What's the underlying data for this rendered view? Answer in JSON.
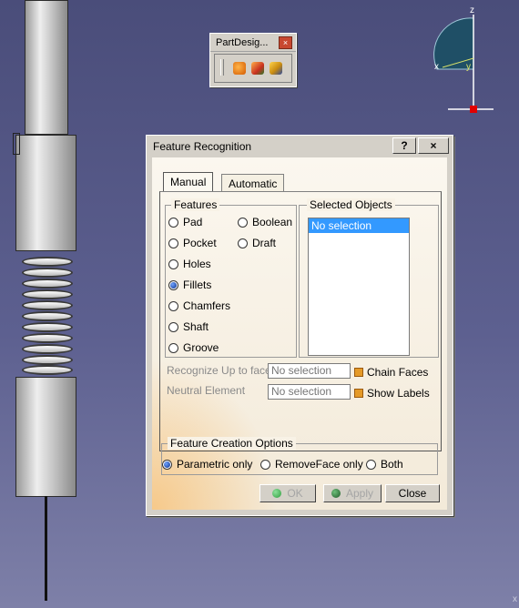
{
  "toolbar": {
    "title": "PartDesig...",
    "close": "×",
    "icons": [
      "recognize-feature-icon",
      "sketch-based-icon",
      "dress-up-icon"
    ]
  },
  "compass": {
    "z": "z",
    "x": "x",
    "y": "y"
  },
  "corner_label": "x",
  "dialog": {
    "title": "Feature Recognition",
    "help": "?",
    "close": "×",
    "tabs": [
      "Manual",
      "Automatic"
    ],
    "features_group": "Features",
    "features": [
      {
        "label": "Pad",
        "selected": false
      },
      {
        "label": "Boolean",
        "selected": false
      },
      {
        "label": "Pocket",
        "selected": false
      },
      {
        "label": "Draft",
        "selected": false
      },
      {
        "label": "Holes",
        "selected": false
      },
      {
        "label": "Fillets",
        "selected": true
      },
      {
        "label": "Chamfers",
        "selected": false
      },
      {
        "label": "Shaft",
        "selected": false
      },
      {
        "label": "Groove",
        "selected": false
      }
    ],
    "selected_objects_group": "Selected Objects",
    "selected_objects": [
      "No selection"
    ],
    "recognize_up_to_face": {
      "label": "Recognize Up to face",
      "value": "No selection"
    },
    "neutral_element": {
      "label": "Neutral Element",
      "value": "No selection"
    },
    "chain_faces": "Chain Faces",
    "show_labels": "Show Labels",
    "creation_options_group": "Feature Creation Options",
    "creation_options": [
      {
        "label": "Parametric only",
        "selected": true
      },
      {
        "label": "RemoveFace only",
        "selected": false
      },
      {
        "label": "Both",
        "selected": false
      }
    ],
    "buttons": {
      "ok": "OK",
      "apply": "Apply",
      "close": "Close"
    },
    "colors": {
      "ok_dot": "#2e9e3e",
      "apply_dot": "#2c6e35",
      "check": "#e59a28"
    }
  }
}
